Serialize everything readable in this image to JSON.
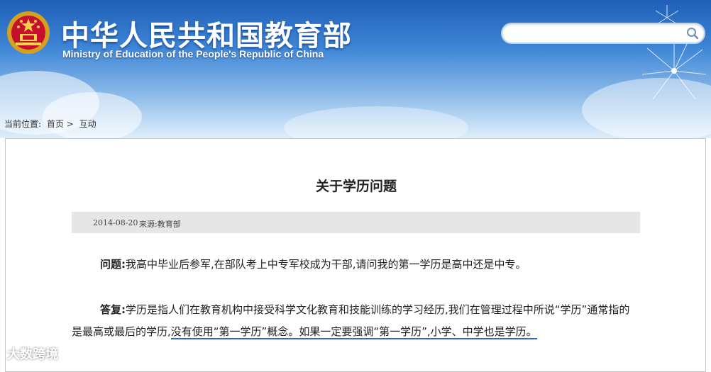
{
  "header": {
    "site_title": "中华人民共和国教育部",
    "site_subtitle": "Ministry of Education of the People's Republic of China",
    "search_placeholder": ""
  },
  "breadcrumb": {
    "prefix": "当前位置:",
    "items": [
      "首页",
      ">",
      "互动"
    ]
  },
  "article": {
    "title": "关于学历问题",
    "date": "2014-08-20",
    "source": "来源:教育部",
    "question_label": "问题:",
    "question_text": "我高中毕业后参军,在部队考上中专军校成为干部,请问我的第一学历是高中还是中专。",
    "answer_label": "答复:",
    "answer_text_1": "学历是指人们在教育机构中接受科学文化教育和技能训练的学习经历,我们在管理过程中所说“学历”通常指的是最高或最后的学历,",
    "answer_text_2": "没有使用“第一学历”概念。如果一定要强调“第一学历”,小学、中学也是学历。"
  },
  "watermark": {
    "text": "大数跨境"
  },
  "colors": {
    "header_dark": "#1f5fb8",
    "header_light": "#dfeefb",
    "meta_bg": "#e6e6e6",
    "underline": "#2f66c9"
  }
}
